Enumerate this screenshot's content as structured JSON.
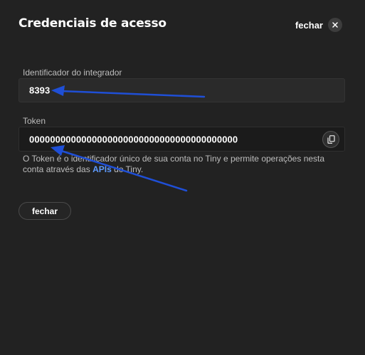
{
  "modal": {
    "title": "Credenciais de acesso",
    "close_label": "fechar"
  },
  "integrator": {
    "label": "Identificador do integrador",
    "value": "8393"
  },
  "token": {
    "label": "Token",
    "value": "0000000000000000000000000000000000000000"
  },
  "help": {
    "text_before": "O Token é o identificador único de sua conta no Tiny e permite operações nesta conta através das ",
    "link": "APIs",
    "text_after": " do Tiny."
  },
  "footer": {
    "close_button": "fechar"
  },
  "colors": {
    "background": "#222222",
    "link": "#5e9bff",
    "annotation_arrow": "#1f4fd6"
  },
  "icons": {
    "close": "close-icon",
    "copy": "copy-icon"
  }
}
